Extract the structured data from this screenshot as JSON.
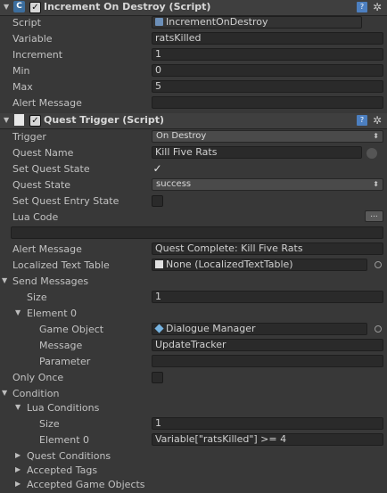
{
  "component1": {
    "title": "Increment On Destroy (Script)",
    "fields": {
      "script_label": "Script",
      "script_value": "IncrementOnDestroy",
      "variable_label": "Variable",
      "variable_value": "ratsKilled",
      "increment_label": "Increment",
      "increment_value": "1",
      "min_label": "Min",
      "min_value": "0",
      "max_label": "Max",
      "max_value": "5",
      "alert_label": "Alert Message",
      "alert_value": ""
    }
  },
  "component2": {
    "title": "Quest Trigger (Script)",
    "fields": {
      "trigger_label": "Trigger",
      "trigger_value": "On Destroy",
      "quest_name_label": "Quest Name",
      "quest_name_value": "Kill Five Rats",
      "set_quest_state_label": "Set Quest State",
      "quest_state_label": "Quest State",
      "quest_state_value": "success",
      "set_entry_state_label": "Set Quest Entry State",
      "lua_code_label": "Lua Code",
      "lua_button": "...",
      "alert_label": "Alert Message",
      "alert_value": "Quest Complete: Kill Five Rats",
      "localized_label": "Localized Text Table",
      "localized_value": "None (LocalizedTextTable)",
      "send_messages_label": "Send Messages",
      "size_label": "Size",
      "size_value": "1",
      "element0_label": "Element 0",
      "game_object_label": "Game Object",
      "game_object_value": "Dialogue Manager",
      "message_label": "Message",
      "message_value": "UpdateTracker",
      "parameter_label": "Parameter",
      "parameter_value": "",
      "only_once_label": "Only Once",
      "condition_label": "Condition",
      "lua_conditions_label": "Lua Conditions",
      "lua_size_label": "Size",
      "lua_size_value": "1",
      "lua_element0_label": "Element 0",
      "lua_element0_value": "Variable[\"ratsKilled\"] >= 4",
      "quest_conditions_label": "Quest Conditions",
      "accepted_tags_label": "Accepted Tags",
      "accepted_game_objects_label": "Accepted Game Objects"
    },
    "checkboxes": {
      "set_quest_state": true,
      "set_quest_entry_state": false,
      "only_once": false
    }
  }
}
